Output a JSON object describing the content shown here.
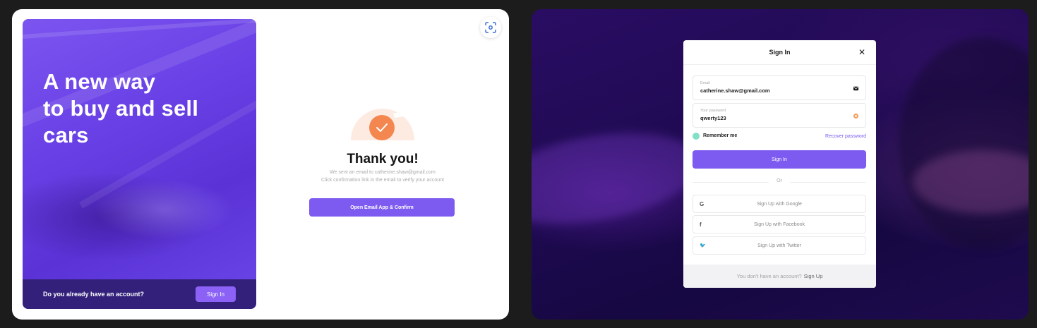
{
  "left": {
    "hero_title": "A new way\nto buy and sell\ncars",
    "footer_question": "Do you already have an account?",
    "footer_signin": "Sign In",
    "thanks_heading": "Thank you!",
    "thanks_line1": "We sent an email to catherine.shaw@gmail.com",
    "thanks_line2": "Click confirmation link in the email to verify your account",
    "confirm_button": "Open Email App & Confirm"
  },
  "modal": {
    "title": "Sign In",
    "close_glyph": "✕",
    "email_label": "Email",
    "email_value": "catherine.shaw@gmail.com",
    "password_label": "Your password",
    "password_value": "qwerty123",
    "remember_label": "Remember me",
    "recover_link": "Recover password",
    "signin_button": "Sign In",
    "or_text": "Or",
    "social": [
      {
        "icon": "google-icon",
        "glyph": "G",
        "label": "Sign Up with Google"
      },
      {
        "icon": "facebook-icon",
        "glyph": "f",
        "label": "Sign Up with Facebook"
      },
      {
        "icon": "twitter-icon",
        "glyph": "🐦",
        "label": "Sign Up with Twitter"
      }
    ],
    "footer_text": "You don't have an account?",
    "footer_link": "Sign Up"
  },
  "colors": {
    "accent": "#7d5bf0",
    "hero": "#6a41e6",
    "success": "#f4874f",
    "remember": "#82e0c8"
  }
}
